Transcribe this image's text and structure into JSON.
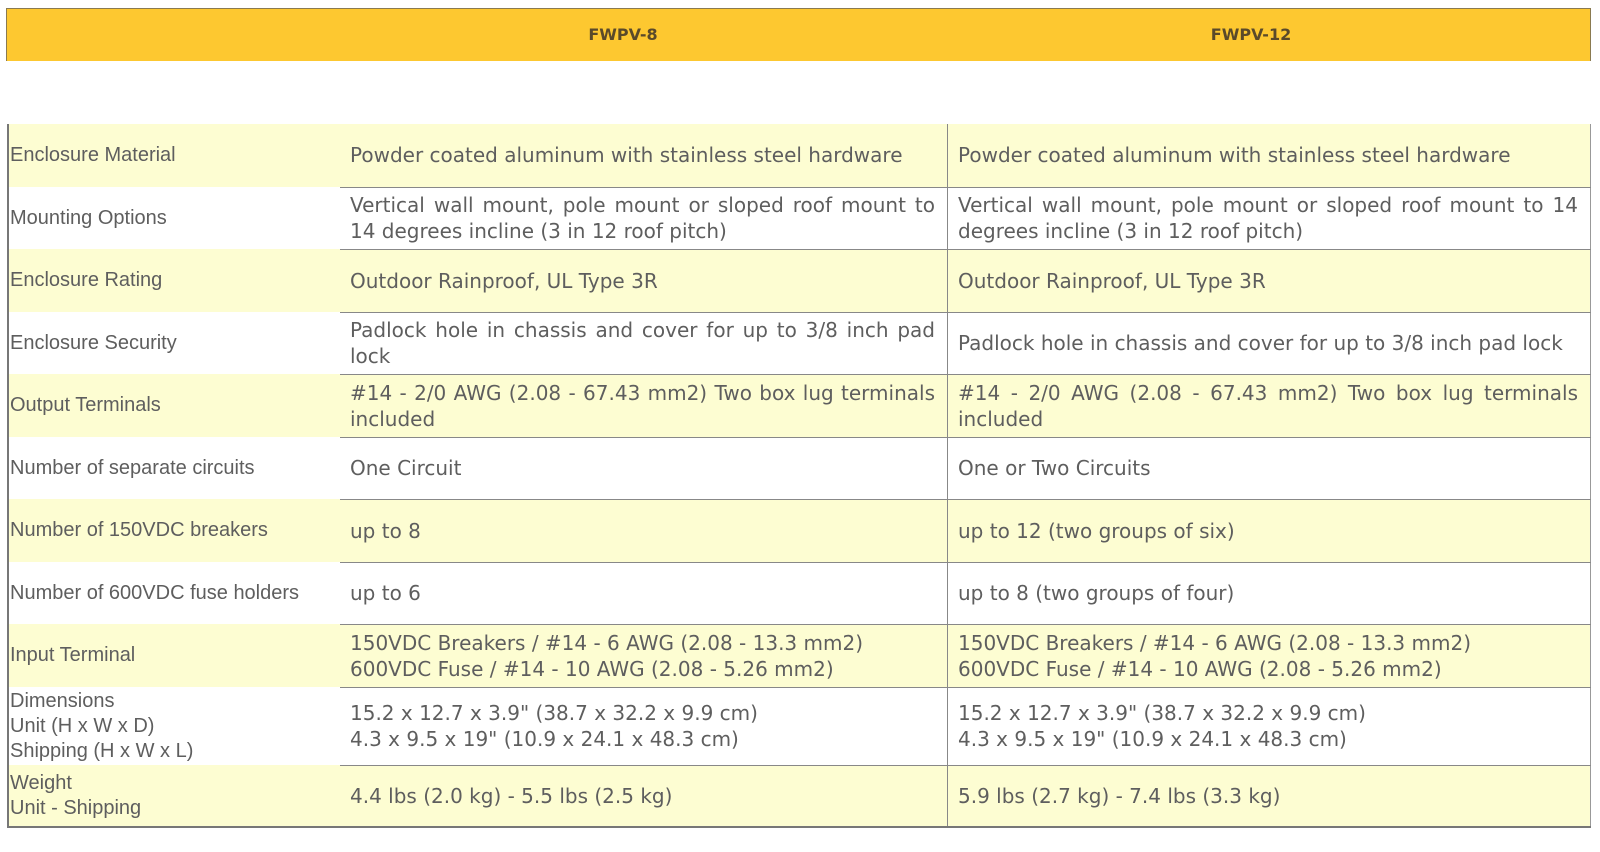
{
  "header": {
    "col1": "FWPV-8",
    "col2": "FWPV-12"
  },
  "rows": [
    {
      "label": [
        "Enclosure Material"
      ],
      "fwpv8": [
        "Powder coated aluminum with stainless steel hardware"
      ],
      "fwpv12": [
        "Powder coated aluminum with stainless steel hardware"
      ]
    },
    {
      "label": [
        "Mounting Options"
      ],
      "fwpv8": [
        "Vertical wall mount, pole mount or sloped roof mount to 14 degrees incline (3 in 12 roof pitch)"
      ],
      "fwpv12": [
        "Vertical wall mount, pole mount or sloped roof mount to 14 degrees incline (3 in 12 roof pitch)"
      ]
    },
    {
      "label": [
        "Enclosure Rating"
      ],
      "fwpv8": [
        "Outdoor Rainproof, UL Type 3R"
      ],
      "fwpv12": [
        "Outdoor Rainproof, UL Type 3R"
      ]
    },
    {
      "label": [
        "Enclosure Security"
      ],
      "fwpv8": [
        "Padlock hole in chassis and cover for up to 3/8 inch pad lock"
      ],
      "fwpv12": [
        "Padlock hole in chassis and cover for up to 3/8 inch pad lock"
      ]
    },
    {
      "label": [
        "Output Terminals"
      ],
      "fwpv8": [
        "#14 - 2/0 AWG (2.08 - 67.43 mm2) Two box lug terminals included"
      ],
      "fwpv12": [
        "#14 - 2/0 AWG (2.08 - 67.43 mm2) Two box lug terminals included"
      ]
    },
    {
      "label": [
        "Number of separate circuits"
      ],
      "fwpv8": [
        "One Circuit"
      ],
      "fwpv12": [
        "One or Two Circuits"
      ]
    },
    {
      "label": [
        "Number of 150VDC breakers"
      ],
      "fwpv8": [
        "up to 8"
      ],
      "fwpv12": [
        "up to 12 (two groups of six)"
      ]
    },
    {
      "label": [
        "Number of 600VDC fuse holders"
      ],
      "fwpv8": [
        "up to 6"
      ],
      "fwpv12": [
        "up to 8 (two groups of four)"
      ]
    },
    {
      "label": [
        "Input Terminal"
      ],
      "fwpv8": [
        "150VDC Breakers / #14 - 6 AWG (2.08 - 13.3 mm2)",
        "600VDC Fuse / #14 - 10 AWG (2.08 - 5.26 mm2)"
      ],
      "fwpv12": [
        "150VDC Breakers / #14 - 6 AWG (2.08 - 13.3 mm2)",
        "600VDC Fuse / #14 - 10 AWG (2.08 - 5.26 mm2)"
      ]
    },
    {
      "label": [
        "Dimensions",
        "Unit (H x W x D)",
        "Shipping (H x W x L)"
      ],
      "fwpv8": [
        "15.2 x 12.7 x 3.9\" (38.7 x 32.2 x 9.9 cm)",
        "4.3 x 9.5 x 19\" (10.9 x 24.1 x 48.3 cm)"
      ],
      "fwpv12": [
        "15.2 x 12.7 x 3.9\" (38.7 x 32.2 x 9.9 cm)",
        "4.3 x 9.5 x 19\" (10.9 x 24.1 x 48.3 cm)"
      ]
    },
    {
      "label": [
        "Weight",
        "Unit - Shipping"
      ],
      "fwpv8": [
        "4.4 lbs (2.0 kg) - 5.5 lbs (2.5 kg)"
      ],
      "fwpv12": [
        "5.9 lbs (2.7 kg) - 7.4 lbs (3.3 kg)"
      ]
    }
  ]
}
